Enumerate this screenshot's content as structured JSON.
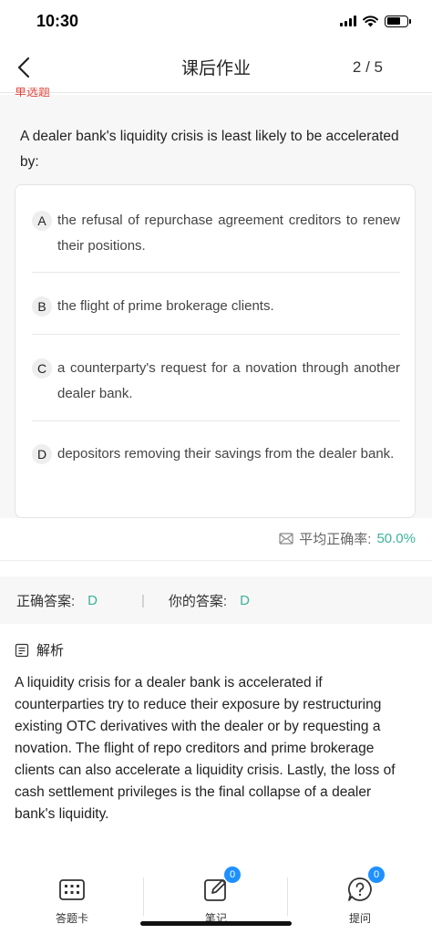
{
  "status_bar": {
    "time": "10:30"
  },
  "nav": {
    "title": "课后作业",
    "page_indicator": "2 / 5"
  },
  "question": {
    "type_label": "单选题",
    "text": "A dealer bank's liquidity crisis is least likely to be accelerated by:",
    "options": [
      {
        "letter": "A",
        "text": "the refusal of repurchase agreement creditors to renew their positions."
      },
      {
        "letter": "B",
        "text": "the flight of prime brokerage clients."
      },
      {
        "letter": "C",
        "text": "a counterparty's request for a novation through another dealer bank."
      },
      {
        "letter": "D",
        "text": "depositors removing their savings from the dealer bank."
      }
    ]
  },
  "stats": {
    "label": "平均正确率:",
    "value": "50.0%"
  },
  "answers": {
    "correct_label": "正确答案:",
    "correct_value": "D",
    "yours_label": "你的答案:",
    "yours_value": "D"
  },
  "analysis": {
    "title": "解析",
    "text": "A liquidity crisis for a dealer bank is accelerated if counterparties try to reduce their exposure by restructuring existing OTC derivatives with the dealer or by requesting a novation. The flight of repo creditors and prime brokerage clients can also accelerate a liquidity crisis. Lastly, the loss of cash settlement privileges is the final collapse of a dealer bank's liquidity."
  },
  "tabs": [
    {
      "label": "答题卡",
      "icon": "answer-card-icon"
    },
    {
      "label": "笔记",
      "icon": "note-icon",
      "badge": "0"
    },
    {
      "label": "提问",
      "icon": "question-icon",
      "badge": "0"
    }
  ],
  "colors": {
    "accent_green": "#3cb39a",
    "badge_blue": "#1e90ff",
    "type_red": "#e2463d"
  }
}
